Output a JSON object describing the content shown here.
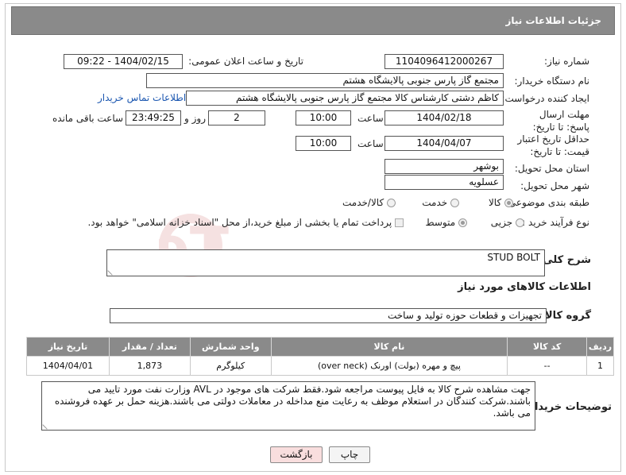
{
  "header": {
    "title": "جزئیات اطلاعات نیاز"
  },
  "form": {
    "need_number_label": "شماره نیاز:",
    "need_number": "1104096412000267",
    "announce_label": "تاریخ و ساعت اعلان عمومی:",
    "announce_value": "1404/02/15 - 09:22",
    "buyer_org_label": "نام دستگاه خریدار:",
    "buyer_org": "مجتمع گاز پارس جنوبی  پالایشگاه هشتم",
    "requester_label": "ایجاد کننده درخواست:",
    "requester": "کاظم دشتی کارشناس کالا مجتمع گاز پارس جنوبی  پالایشگاه هشتم",
    "contact_link": "اطلاعات تماس خریدار",
    "deadline_label": "مهلت ارسال پاسخ: تا تاریخ:",
    "deadline_date": "1404/02/18",
    "time_label": "ساعت",
    "deadline_time": "10:00",
    "days_value": "2",
    "days_label": "روز و",
    "remaining_time": "23:49:25",
    "remaining_label": "ساعت باقی مانده",
    "price_validity_label": "حداقل تاریخ اعتبار قیمت: تا تاریخ:",
    "price_validity_date": "1404/04/07",
    "price_validity_time": "10:00",
    "province_label": "استان محل تحویل:",
    "province": "بوشهر",
    "city_label": "شهر محل تحویل:",
    "city": "عسلویه",
    "category_label": "طبقه بندی موضوعی:",
    "category_options": [
      "کالا",
      "خدمت",
      "کالا/خدمت"
    ],
    "process_label": "نوع فرآیند خرید :",
    "process_options": [
      "جزیی",
      "متوسط"
    ],
    "payment_note": "پرداخت تمام یا بخشی از مبلغ خرید،از محل \"اسناد خزانه اسلامی\" خواهد بود."
  },
  "description": {
    "label": "شرح کلی نیاز:",
    "value": "STUD BOLT"
  },
  "goods": {
    "section_title": "اطلاعات کالاهای مورد نیاز",
    "group_label": "گروه کالا:",
    "group_value": "تجهیزات و قطعات حوزه تولید و ساخت",
    "columns": [
      "ردیف",
      "کد کالا",
      "نام کالا",
      "واحد شمارش",
      "تعداد / مقدار",
      "تاریخ نیاز"
    ],
    "rows": [
      {
        "row": "1",
        "code": "--",
        "name": "پیچ و مهره (بولت) اورنک (over neck)",
        "unit": "کیلوگرم",
        "qty": "1,873",
        "date": "1404/04/01"
      }
    ]
  },
  "notes": {
    "label": "توضیحات خریدار:",
    "value": "جهت مشاهده شرح کالا به فایل پیوست مراجعه شود.فقط شرکت های موجود در AVL وزارت نفت مورد تایید می باشند.شرکت کنندگان در استعلام موظف به رعایت منع مداخله در معاملات دولتی می باشند.هزینه حمل بر عهده فروشنده می باشد."
  },
  "buttons": {
    "print": "چاپ",
    "back": "بازگشت"
  },
  "watermark": {
    "text": "AriaTender.neT"
  },
  "colors": {
    "header_bg": "#8a8a8a",
    "link": "#1a56b0",
    "back_button_bg": "#f9dede",
    "watermark": "#b51f1f"
  }
}
